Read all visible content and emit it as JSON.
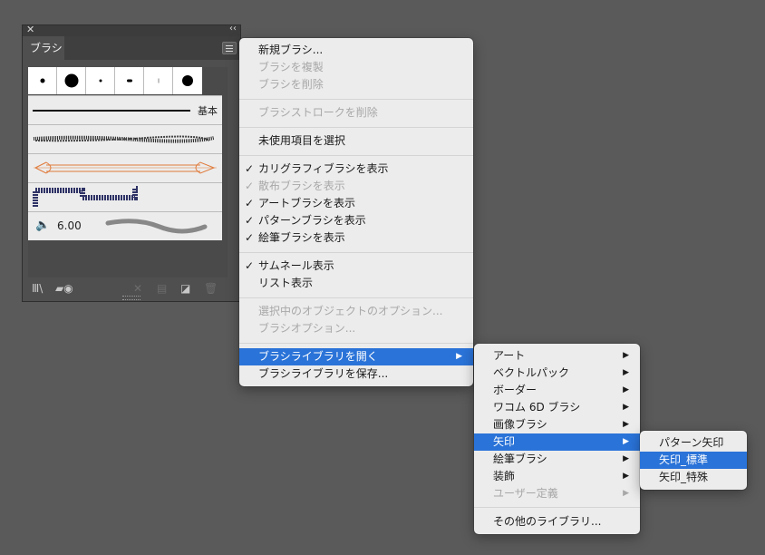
{
  "panel": {
    "close_glyph": "✕",
    "collapse_glyph": "‹‹",
    "tab_label": "ブラシ",
    "basic_brush_label": "基本",
    "pattern_brush_size": "6.00"
  },
  "main_menu": {
    "new_brush": "新規ブラシ...",
    "duplicate_brush": "ブラシを複製",
    "delete_brush": "ブラシを削除",
    "remove_brush_stroke": "ブラシストロークを削除",
    "select_unused": "未使用項目を選択",
    "show_calligraphic": "カリグラフィブラシを表示",
    "show_scatter": "散布ブラシを表示",
    "show_art": "アートブラシを表示",
    "show_pattern": "パターンブラシを表示",
    "show_bristle": "絵筆ブラシを表示",
    "thumbnail_view": "サムネール表示",
    "list_view": "リスト表示",
    "options_selected": "選択中のオブジェクトのオプション...",
    "brush_options": "ブラシオプション...",
    "open_library": "ブラシライブラリを開く",
    "save_library": "ブラシライブラリを保存...",
    "check_glyph": "✓",
    "arrow_glyph": "▶"
  },
  "library_menu": {
    "art": "アート",
    "vector_pack": "ベクトルパック",
    "borders": "ボーダー",
    "wacom": "ワコム 6D ブラシ",
    "image_brush": "画像ブラシ",
    "arrows": "矢印",
    "bristle": "絵筆ブラシ",
    "decorative": "装飾",
    "user_defined": "ユーザー定義",
    "other_library": "その他のライブラリ..."
  },
  "arrows_menu": {
    "pattern_arrows": "パターン矢印",
    "arrows_standard": "矢印_標準",
    "arrows_special": "矢印_特殊"
  },
  "colors": {
    "highlight": "#2a73d8",
    "menu_bg": "#ececec",
    "background": "#5a5a5a"
  }
}
